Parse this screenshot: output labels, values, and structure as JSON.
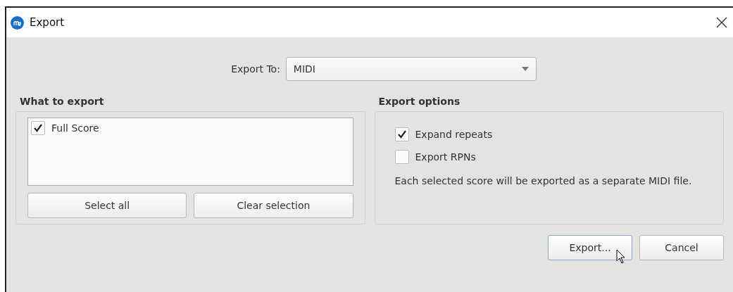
{
  "window": {
    "title": "Export"
  },
  "export_to": {
    "label": "Export To:",
    "value": "MIDI"
  },
  "what_to_export": {
    "title": "What to export",
    "items": [
      {
        "label": "Full Score",
        "checked": true
      }
    ],
    "buttons": [
      "Select all",
      "Clear selection"
    ]
  },
  "export_options": {
    "title": "Export options",
    "options": [
      {
        "label": "Expand repeats",
        "checked": true
      },
      {
        "label": "Export RPNs",
        "checked": false
      }
    ],
    "note": "Each selected score will be exported as a separate MIDI file."
  },
  "buttons": [
    {
      "label": "Export...",
      "default": true
    },
    {
      "label": "Cancel",
      "default": false
    }
  ]
}
